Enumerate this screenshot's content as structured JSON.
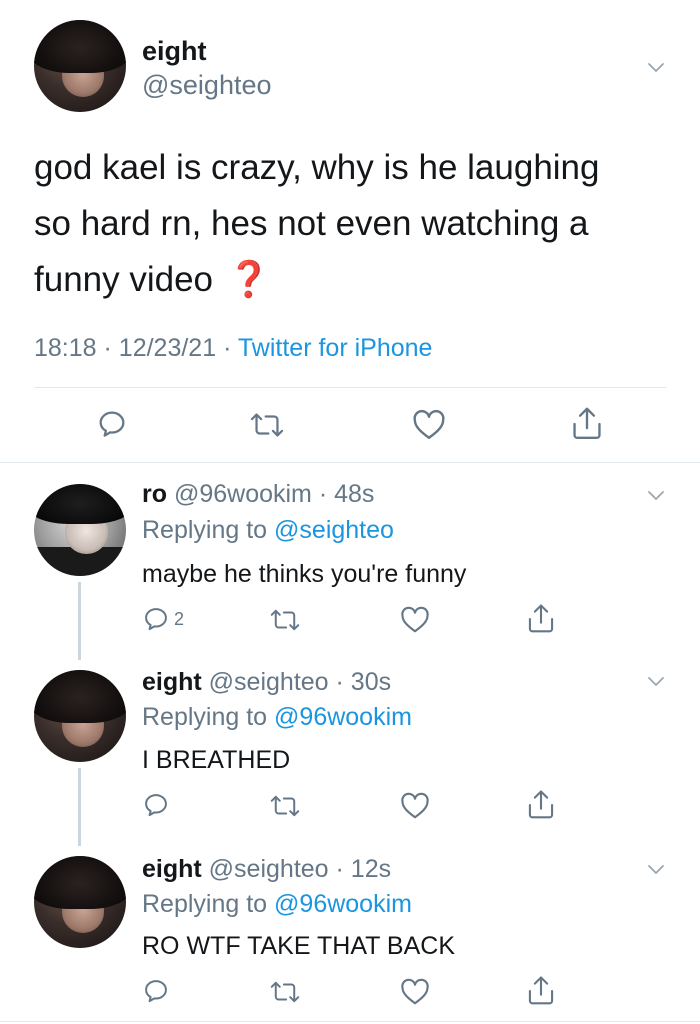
{
  "main_tweet": {
    "name": "eight",
    "handle": "@seighteo",
    "text_lines": [
      "god kael is crazy, why is he laughing",
      "so hard rn, hes not even watching a",
      "funny video"
    ],
    "emoji": "❓",
    "time": "18:18",
    "date": "12/23/21",
    "source": "Twitter for iPhone",
    "sep": "·"
  },
  "replies": [
    {
      "name": "ro",
      "handle_time": "@96wookim · 48s",
      "replying_prefix": "Replying to",
      "replying_to": "@seighteo",
      "text": "maybe he thinks you're funny",
      "reply_count": "2"
    },
    {
      "name": "eight",
      "handle_time": "@seighteo · 30s",
      "replying_prefix": "Replying to",
      "replying_to": "@96wookim",
      "text": "I BREATHED",
      "reply_count": ""
    },
    {
      "name": "eight",
      "handle_time": "@seighteo · 12s",
      "replying_prefix": "Replying to",
      "replying_to": "@96wookim",
      "text": "RO WTF TAKE THAT BACK",
      "reply_count": ""
    }
  ],
  "icons": {
    "chevron": "chevron-down-icon",
    "reply": "reply-icon",
    "retweet": "retweet-icon",
    "like": "heart-icon",
    "share": "share-icon"
  },
  "colors": {
    "text": "#14171a",
    "secondary": "#657786",
    "link": "#1b95e0",
    "divider": "#e1e8ed",
    "emoji": "#e0243c"
  }
}
